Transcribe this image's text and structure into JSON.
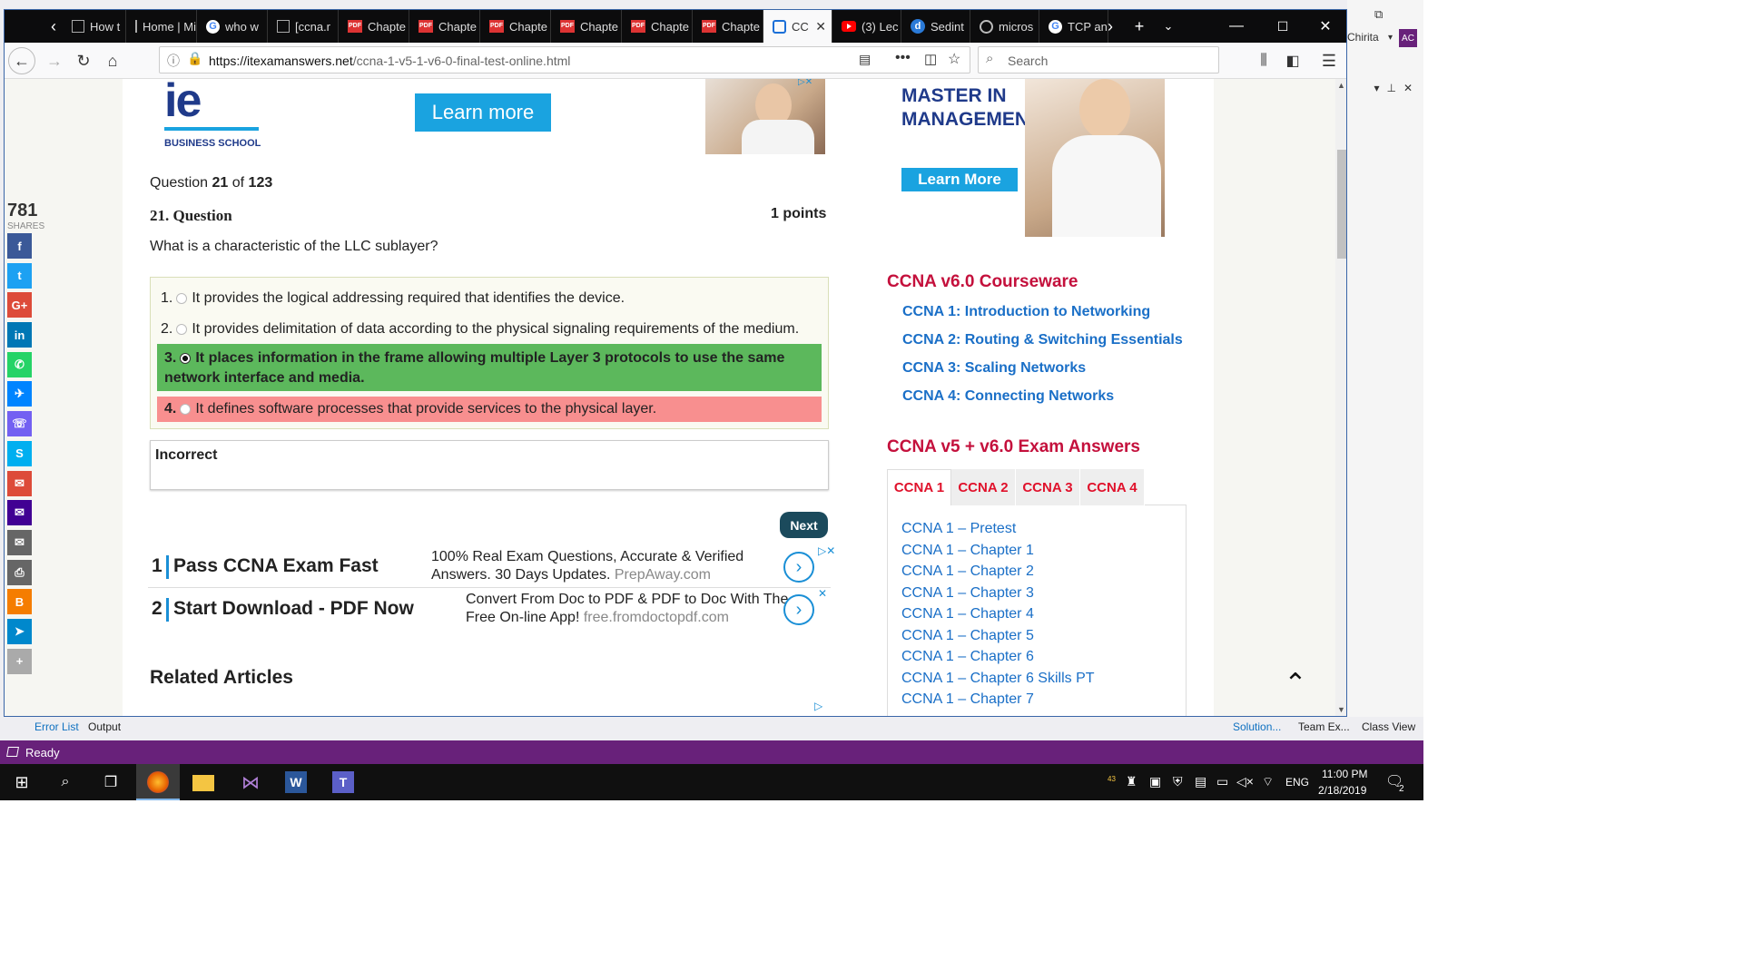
{
  "vs": {
    "user": "Chirita",
    "avatar": "AC",
    "bottom_tabs": [
      "Error List",
      "Output"
    ],
    "right_tabs": [
      "Solution...",
      "Team Ex...",
      "Class View"
    ],
    "status": "Ready"
  },
  "browser": {
    "tabs": [
      {
        "label": "How t",
        "icon": "doc-icon"
      },
      {
        "label": "Home | Mi",
        "icon": "doc-icon"
      },
      {
        "label": "who w",
        "icon": "google-icon"
      },
      {
        "label": "[ccna.r",
        "icon": "doc-icon"
      },
      {
        "label": "Chapte",
        "icon": "pdf-icon"
      },
      {
        "label": "Chapte",
        "icon": "pdf-icon"
      },
      {
        "label": "Chapte",
        "icon": "pdf-icon"
      },
      {
        "label": "Chapte",
        "icon": "pdf-icon"
      },
      {
        "label": "Chapte",
        "icon": "pdf-icon"
      },
      {
        "label": "Chapte",
        "icon": "pdf-icon"
      },
      {
        "label": "CC",
        "icon": "site-icon",
        "active": true
      },
      {
        "label": "(3) Lec",
        "icon": "youtube-icon"
      },
      {
        "label": "Sedint",
        "icon": "d-icon"
      },
      {
        "label": "micros",
        "icon": "github-icon"
      },
      {
        "label": "TCP an",
        "icon": "google-icon"
      }
    ],
    "url_domain": "https://itexamanswers.net",
    "url_path": "/ccna-1-v5-1-v6-0-final-test-online.html",
    "search_placeholder": "Search"
  },
  "shares": {
    "count": "781",
    "label": "SHARES",
    "buttons": [
      {
        "name": "facebook",
        "glyph": "f",
        "color": "#3b5998"
      },
      {
        "name": "twitter",
        "glyph": "t",
        "color": "#1da1f2"
      },
      {
        "name": "googleplus",
        "glyph": "G+",
        "color": "#dd4b39"
      },
      {
        "name": "linkedin",
        "glyph": "in",
        "color": "#0077b5"
      },
      {
        "name": "whatsapp",
        "glyph": "✆",
        "color": "#25d366"
      },
      {
        "name": "messenger",
        "glyph": "✈",
        "color": "#0084ff"
      },
      {
        "name": "viber",
        "glyph": "☏",
        "color": "#7360f2"
      },
      {
        "name": "skype",
        "glyph": "S",
        "color": "#00aff0"
      },
      {
        "name": "gmail",
        "glyph": "✉",
        "color": "#dd4b39"
      },
      {
        "name": "yahoo-mail",
        "glyph": "✉",
        "color": "#410093"
      },
      {
        "name": "email",
        "glyph": "✉",
        "color": "#666666"
      },
      {
        "name": "print",
        "glyph": "⎙",
        "color": "#666666"
      },
      {
        "name": "blogger",
        "glyph": "B",
        "color": "#f57d00"
      },
      {
        "name": "telegram",
        "glyph": "➤",
        "color": "#0088cc"
      },
      {
        "name": "more",
        "glyph": "+",
        "color": "#aaaaaa"
      }
    ]
  },
  "ads": {
    "ie_logo": "ie",
    "ie_sub": "BUSINESS SCHOOL",
    "learn_more": "Learn more",
    "master_line1": "MASTER IN",
    "master_line2": "MANAGEMENT",
    "learn_more_side": "Learn More",
    "rows": [
      {
        "num": "1",
        "title": "Pass CCNA Exam Fast",
        "desc": "100% Real Exam Questions, Accurate & Verified Answers. 30 Days Updates.",
        "site": "PrepAway.com"
      },
      {
        "num": "2",
        "title": "Start Download - PDF Now",
        "desc": "Convert From Doc to PDF & PDF to Doc With The Free On-line App!",
        "site": "free.fromdoctopdf.com"
      }
    ]
  },
  "quiz": {
    "counter_prefix": "Question",
    "counter_current": "21",
    "counter_of": "of",
    "counter_total": "123",
    "title": "21. Question",
    "points": "1 points",
    "question": "What is a characteristic of the LLC sublayer?",
    "options": [
      {
        "num": "1.",
        "text": "It provides the logical addressing required that identifies the device.",
        "state": "neutral"
      },
      {
        "num": "2.",
        "text": "It provides delimitation of data according to the physical signaling requirements of the medium.",
        "state": "neutral"
      },
      {
        "num": "3.",
        "text": "It places information in the frame allowing multiple Layer 3 protocols to use the same network interface and media.",
        "state": "correct"
      },
      {
        "num": "4.",
        "text": "It defines software processes that provide services to the physical layer.",
        "state": "wrong"
      }
    ],
    "result": "Incorrect",
    "next": "Next"
  },
  "related": "Related Articles",
  "sidebar": {
    "courseware_title": "CCNA v6.0 Courseware",
    "courseware": [
      "CCNA 1: Introduction to Networking",
      "CCNA 2: Routing & Switching Essentials",
      "CCNA 3: Scaling Networks",
      "CCNA 4: Connecting Networks"
    ],
    "answers_title": "CCNA v5 + v6.0 Exam Answers",
    "tabs": [
      "CCNA 1",
      "CCNA 2",
      "CCNA 3",
      "CCNA 4"
    ],
    "chapters": [
      "CCNA 1 – Pretest",
      "CCNA 1 – Chapter 1",
      "CCNA 1 – Chapter 2",
      "CCNA 1 – Chapter 3",
      "CCNA 1 – Chapter 4",
      "CCNA 1 – Chapter 5",
      "CCNA 1 – Chapter 6",
      "CCNA 1 – Chapter 6 Skills PT",
      "CCNA 1 – Chapter 7"
    ]
  },
  "taskbar": {
    "time": "11:00 PM",
    "date": "2/18/2019",
    "lang": "ENG",
    "notif": "2",
    "tray_num": "43"
  },
  "colors": {
    "correct": "#5cb85c",
    "wrong": "#f88f8f",
    "accent_red": "#c4103c",
    "link_blue": "#1a6fc7",
    "vs_purple": "#68217a"
  }
}
